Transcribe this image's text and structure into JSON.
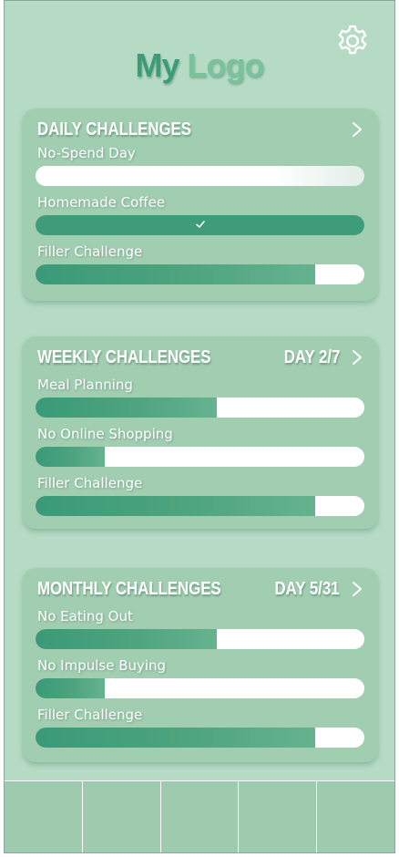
{
  "app": {
    "logo_word1": "My",
    "logo_word2": "Logo",
    "settings_icon": "gear-icon"
  },
  "colors": {
    "background": "#b5dbc5",
    "card": "#a1cdb1",
    "progress_fill": "#3e9c78",
    "progress_track": "#ffffff",
    "logo_primary": "#3d9b78",
    "logo_secondary": "#79c29c"
  },
  "daily": {
    "title": "DAILY CHALLENGES",
    "chevron_icon": "chevron-right-icon",
    "items": [
      {
        "label": "No-Spend Day",
        "progress": 0
      },
      {
        "label": "Homemade Coffee",
        "progress": 1.0,
        "completed": true,
        "status_icon": "checkmark-icon"
      },
      {
        "label": "Filler Challenge",
        "progress": 0.85
      }
    ]
  },
  "weekly": {
    "title": "WEEKLY CHALLENGES",
    "day": "DAY 2/7",
    "chevron_icon": "chevron-right-icon",
    "items": [
      {
        "label": "Meal Planning",
        "progress": 0.55
      },
      {
        "label": "No Online Shopping",
        "progress": 0.21
      },
      {
        "label": "Filler Challenge",
        "progress": 0.85
      }
    ]
  },
  "monthly": {
    "title": "MONTHLY CHALLENGES",
    "day": "DAY 5/31",
    "chevron_icon": "chevron-right-icon",
    "items": [
      {
        "label": "No Eating Out",
        "progress": 0.55
      },
      {
        "label": "No Impulse Buying",
        "progress": 0.21
      },
      {
        "label": "Filler Challenge",
        "progress": 0.85
      }
    ]
  },
  "navbar": {
    "slot_count": 5
  }
}
